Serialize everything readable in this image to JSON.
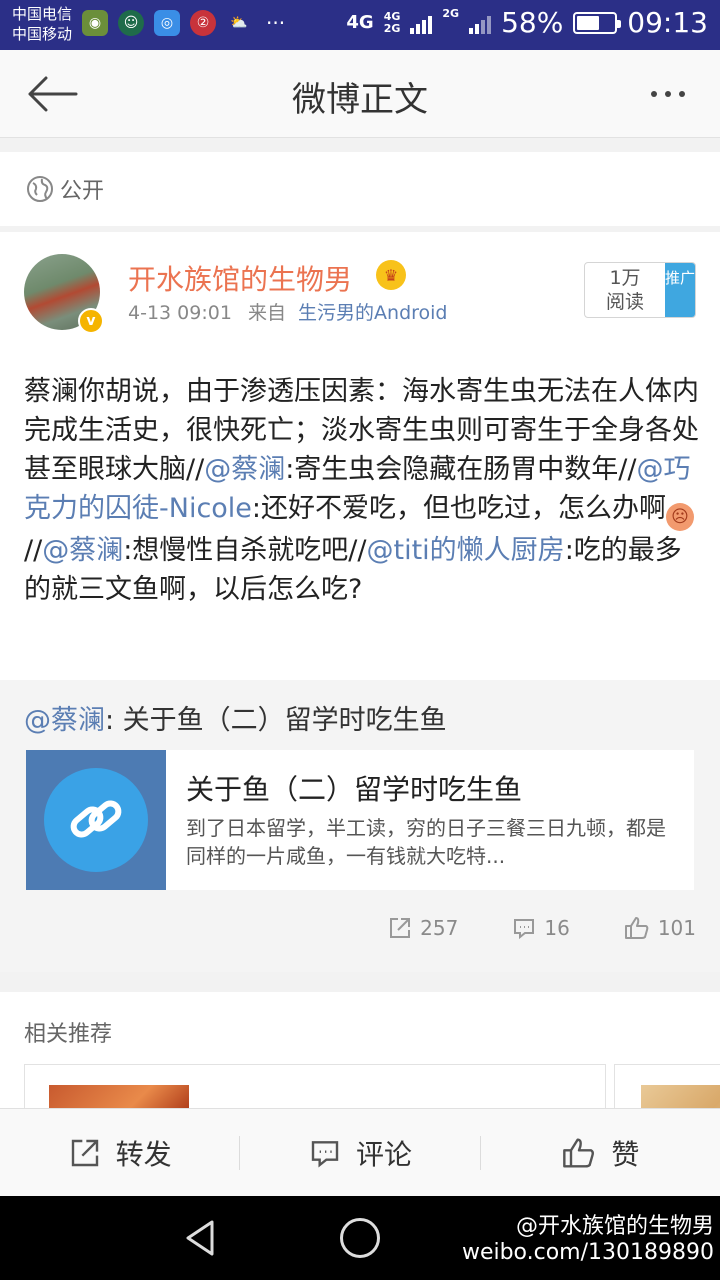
{
  "status_bar": {
    "carrier1": "中国电信",
    "carrier2": "中国移动",
    "net_main": "4G",
    "net_small_top": "4G",
    "net_small_bottom": "2G",
    "net_third": "2G",
    "battery": "58%",
    "time": "09:13"
  },
  "header": {
    "title": "微博正文"
  },
  "visibility": {
    "label": "公开"
  },
  "post": {
    "author": "开水族馆的生物男",
    "time": "4-13 09:01",
    "source_prefix": "来自",
    "source": "生污男的Android",
    "read_count": "1万",
    "read_label": "阅读",
    "promote_label": "推广",
    "text_seg1": "蔡澜你胡说，由于渗透压因素：海水寄生虫无法在人体内完成生活史，很快死亡；淡水寄生虫则可寄生于全身各处甚至眼球大脑//",
    "mention1": "@蔡澜",
    "text_seg2": ":寄生虫会隐藏在肠胃中数年//",
    "mention2": "@巧克力的囚徒-Nicole",
    "text_seg3": ":还好不爱吃，但也吃过，怎么办啊",
    "text_seg4": " //",
    "mention3": "@蔡澜",
    "text_seg5": ":想慢性自杀就吃吧//",
    "mention4": "@titi的懒人厨房",
    "text_seg6": ":吃的最多的就三文鱼啊，以后怎么吃?"
  },
  "repost": {
    "mention": "@蔡澜",
    "text": ": 关于鱼（二）留学时吃生鱼",
    "card_title": "关于鱼（二）留学时吃生鱼",
    "card_desc": "到了日本留学，半工读，穷的日子三餐三日九顿，都是同样的一片咸鱼，一有钱就大吃特..."
  },
  "stats": {
    "reposts": "257",
    "comments": "16",
    "likes": "101"
  },
  "related": {
    "title": "相关推荐"
  },
  "actions": {
    "repost": "转发",
    "comment": "评论",
    "like": "赞"
  },
  "watermark": {
    "line1": "@开水族馆的生物男",
    "line2": "weibo.com/130189890"
  },
  "colors": {
    "status_bar": "#2b2f87",
    "author_orange": "#eb7350",
    "link_blue": "#5b7eb3"
  }
}
